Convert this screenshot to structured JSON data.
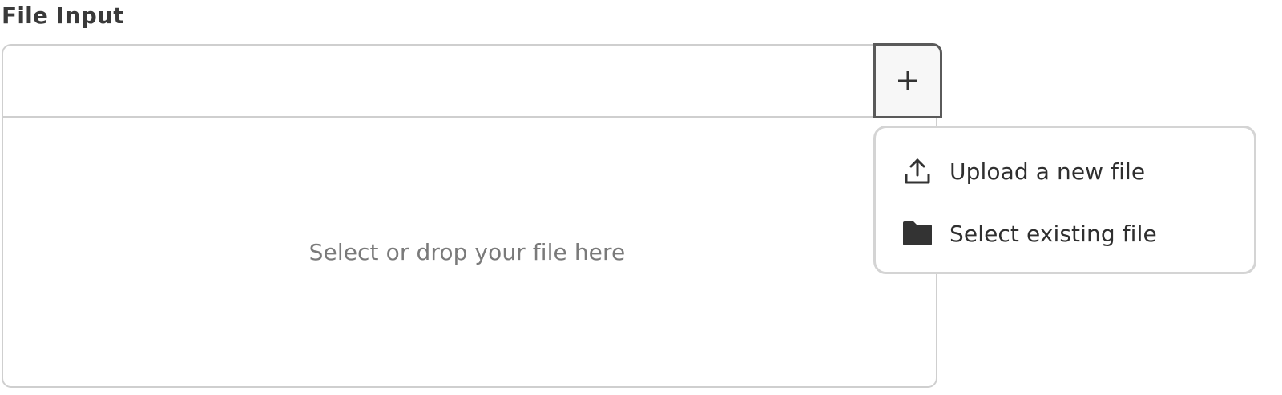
{
  "field": {
    "label": "File Input"
  },
  "dropzone": {
    "text": "Select or drop your file here"
  },
  "add_button": {
    "icon": "plus-icon"
  },
  "menu": {
    "items": [
      {
        "label": "Upload a new file",
        "icon": "upload-icon"
      },
      {
        "label": "Select existing file",
        "icon": "folder-icon"
      }
    ]
  },
  "colors": {
    "border": "#cfcfcf",
    "text": "#2f2f2f",
    "muted_text": "#7a7a7a",
    "button_bg": "#f7f7f7",
    "button_border": "#5a5a5a",
    "icon": "#333333"
  }
}
